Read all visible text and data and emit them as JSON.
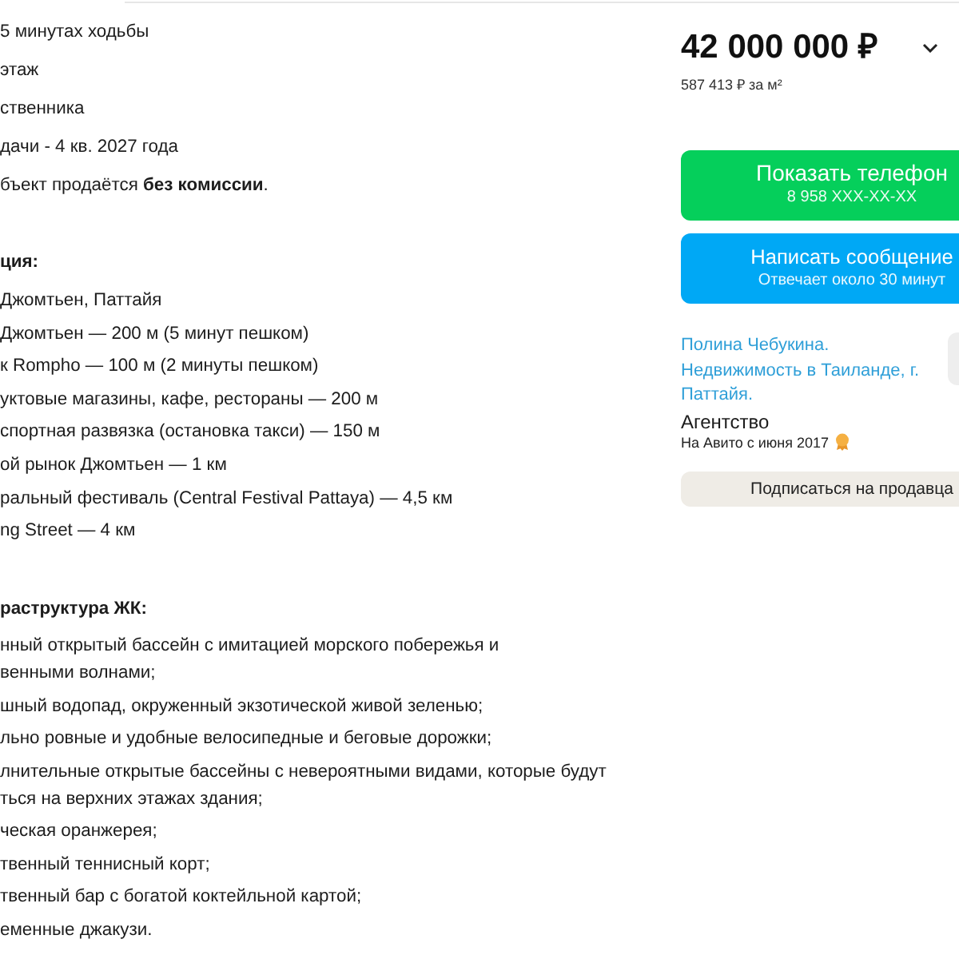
{
  "description": {
    "lines": [
      "5 минутах ходьбы",
      "этаж",
      "ственника",
      "дачи - 4 кв. 2027 года",
      "бъект продаётся **без комиссии**."
    ],
    "location": {
      "heading": "ция:",
      "items": [
        "Джомтьен, Паттайя",
        "Джомтьен — 200 м (5 минут пешком)",
        "к Rompho — 100 м (2 минуты пешком)",
        "уктовые магазины, кафе, рестораны — 200 м",
        "спортная развязка (остановка такси) — 150 м",
        "ой рынок Джомтьен — 1 км",
        "ральный фестиваль (Central Festival Pattaya) — 4,5 км",
        "ng Street — 4 км"
      ]
    },
    "infrastructure": {
      "heading": "раструктура ЖК:",
      "items": [
        {
          "lines": [
            "нный открытый бассейн с имитацией морского побережья и",
            "венными волнами;"
          ]
        },
        {
          "lines": [
            "шный водопад, окруженный экзотической живой зеленью;"
          ]
        },
        {
          "lines": [
            "льно ровные и удобные велосипедные и беговые дорожки;"
          ]
        },
        {
          "lines": [
            "лнительные открытые бассейны с невероятными видами, которые будут",
            "ться на верхних этажах здания;"
          ]
        },
        {
          "lines": [
            "ческая оранжерея;"
          ]
        },
        {
          "lines": [
            "твенный теннисный корт;"
          ]
        },
        {
          "lines": [
            "твенный бар с богатой коктейльной картой;"
          ]
        },
        {
          "lines": [
            "еменные джакузи."
          ]
        }
      ]
    }
  },
  "price": {
    "amount": "42 000 000 ₽",
    "per_meter": "587 413 ₽ за м²"
  },
  "buttons": [
    {
      "kind": "phone",
      "label": "Показать телефон",
      "sublabel": "8 958 XXX-XX-XX"
    },
    {
      "kind": "message",
      "label": "Написать сообщение",
      "sublabel": "Отвечает около 30 минут"
    }
  ],
  "seller": {
    "name": "Полина Чебукина. Недвижимость в Таиланде, г. Паттайя.",
    "type": "Агентство",
    "since": "На Авито с июня 2017",
    "subscribe": "Подписаться на продавца"
  }
}
